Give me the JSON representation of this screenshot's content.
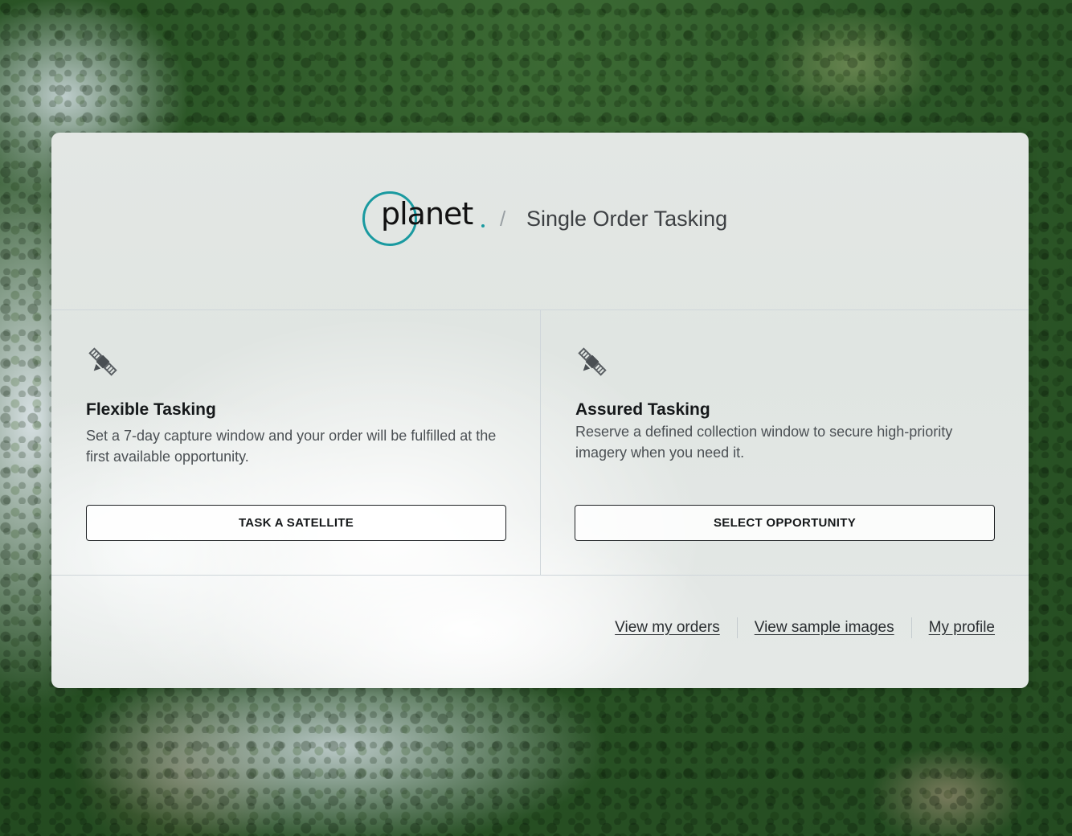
{
  "brand": {
    "logo_text": "planet",
    "logo_color": "#1a9aa0"
  },
  "header": {
    "separator": "/",
    "title": "Single Order Tasking"
  },
  "options": [
    {
      "icon": "satellite-icon",
      "title": "Flexible Tasking",
      "description": "Set a 7-day capture window and your order will be fulfilled at the first available opportunity.",
      "button_label": "TASK A SATELLITE"
    },
    {
      "icon": "satellite-icon",
      "title": "Assured Tasking",
      "description": "Reserve a defined collection window to secure high-priority imagery when you need it.",
      "button_label": "SELECT OPPORTUNITY"
    }
  ],
  "footer": {
    "links": [
      "View my orders",
      "View sample images",
      "My profile"
    ]
  }
}
